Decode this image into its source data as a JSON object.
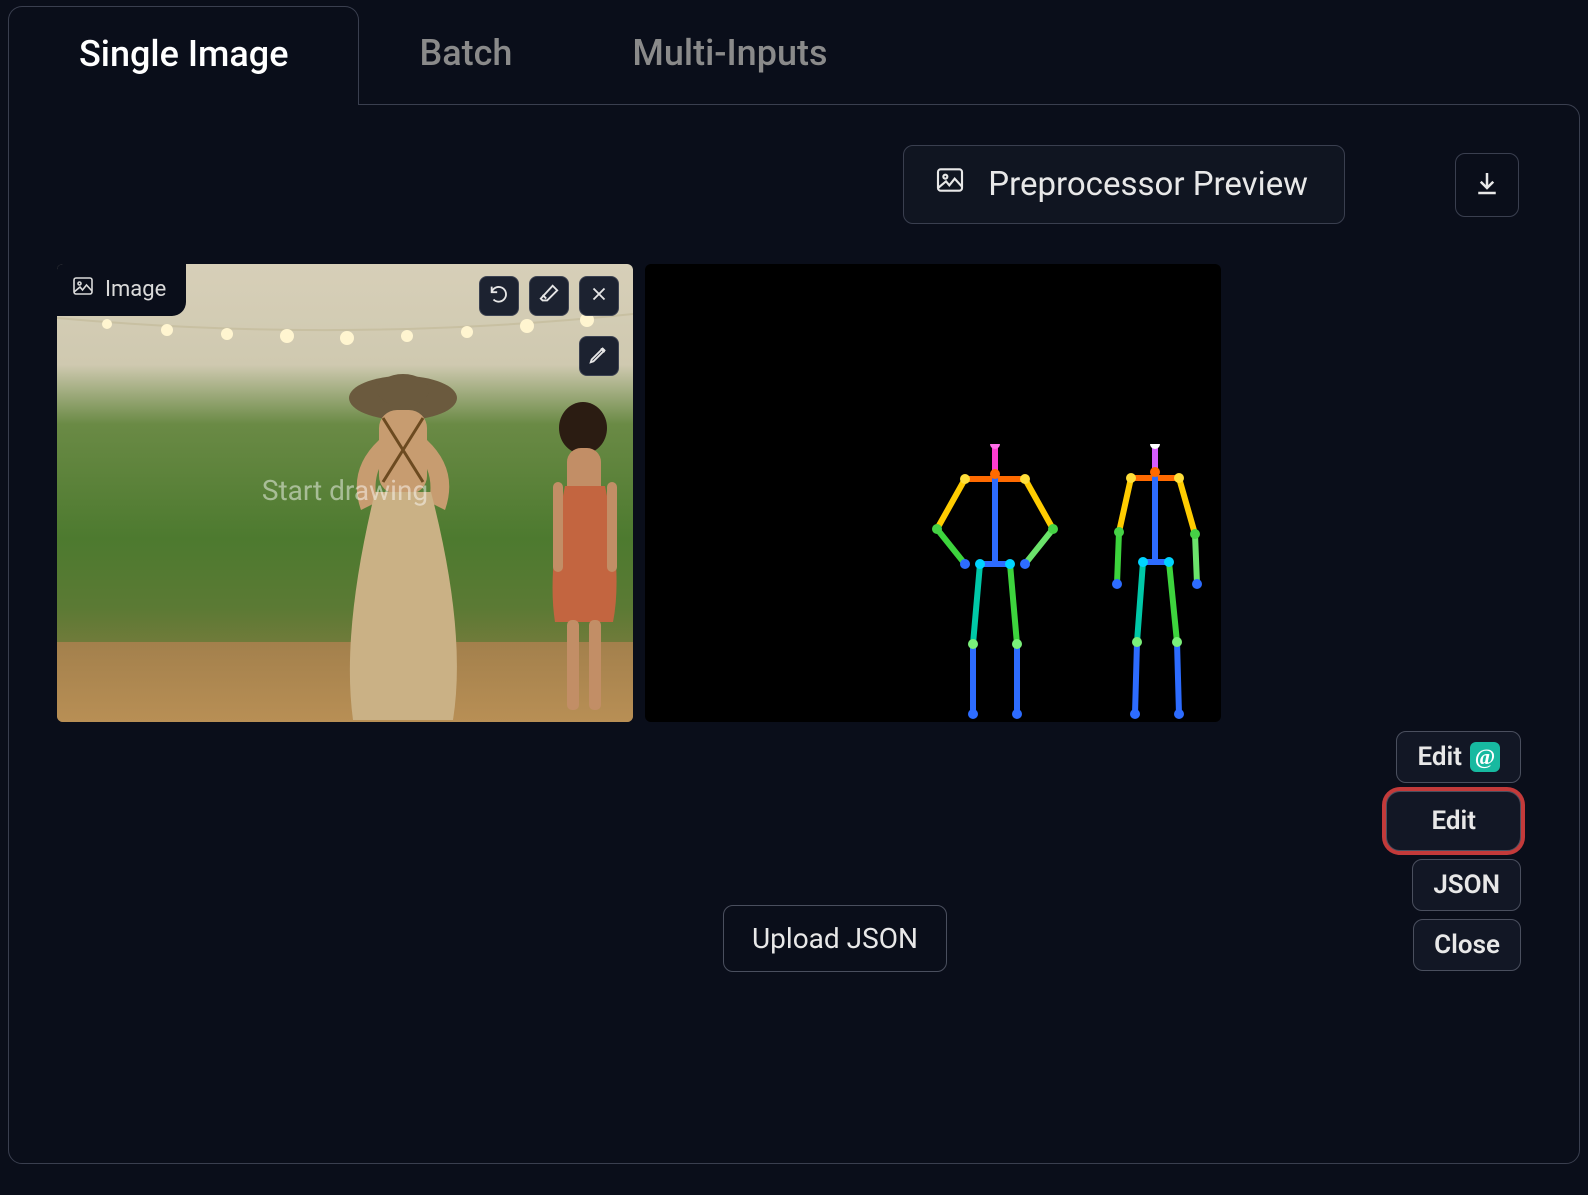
{
  "tabs": {
    "single": "Single Image",
    "batch": "Batch",
    "multi": "Multi-Inputs",
    "active": "single"
  },
  "topbar": {
    "preview_label": "Preprocessor Preview"
  },
  "image": {
    "badge_label": "Image",
    "draw_hint": "Start drawing"
  },
  "actions": {
    "edit_photopea": "Edit",
    "edit": "Edit",
    "json": "JSON",
    "close": "Close",
    "upload_json": "Upload JSON"
  },
  "icons": {
    "image": "image-icon",
    "download": "download-icon",
    "undo": "undo-icon",
    "eraser": "eraser-icon",
    "close_x": "close-icon",
    "pen": "pen-icon"
  }
}
